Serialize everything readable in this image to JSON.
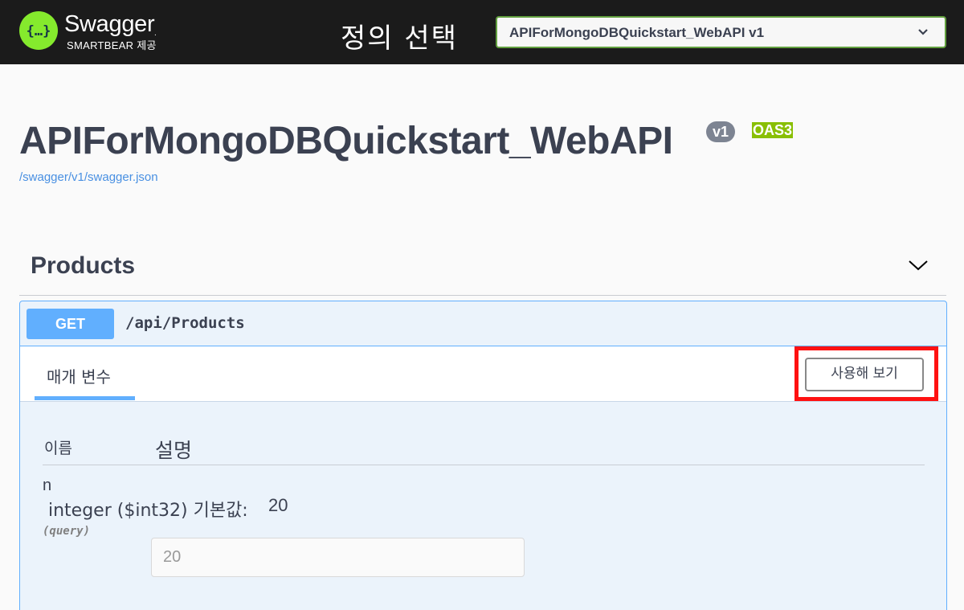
{
  "topbar": {
    "logo_title": "Swagger",
    "logo_tm": ".",
    "logo_subtitle": "SMARTBEAR 제공",
    "select_label": "정의 선택",
    "definition_selected": "APIForMongoDBQuickstart_WebAPI v1",
    "logo_color": "#85ea2d",
    "background_color": "#1b1b1b"
  },
  "info": {
    "title": "APIForMongoDBQuickstart_WebAPI",
    "version_badge": "v1",
    "oas_badge": "OAS3",
    "spec_link": "/swagger/v1/swagger.json"
  },
  "tag": {
    "name": "Products",
    "chevron_icon": "chevron-down-icon"
  },
  "operation": {
    "method": "GET",
    "path": "/api/Products",
    "method_color": "#61affe",
    "tab_label": "매개 변수",
    "try_out_label": "사용해 보기",
    "highlight_color": "#ff1111",
    "columns": {
      "name": "이름",
      "description": "설명"
    },
    "parameter": {
      "name": "n",
      "type_and_default_label": "integer ($int32) 기본값:",
      "default_value": "20",
      "location": "(query)",
      "input_value": "20"
    }
  }
}
